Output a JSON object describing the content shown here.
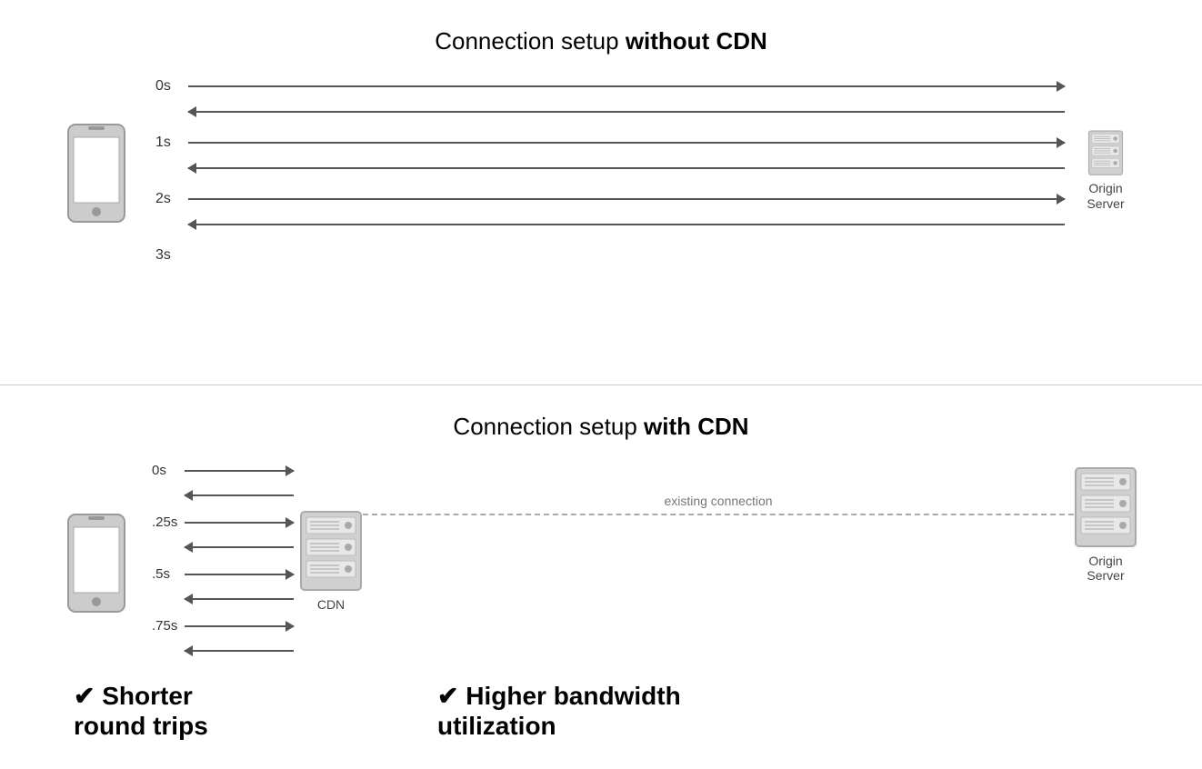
{
  "top_section": {
    "title_normal": "Connection setup ",
    "title_bold": "without CDN",
    "time_labels": [
      "0s",
      "1s",
      "2s",
      "3s"
    ],
    "server_label": "Origin\nServer"
  },
  "bottom_section": {
    "title_normal": "Connection setup ",
    "title_bold": "with CDN",
    "time_labels": [
      "0s",
      ".25s",
      ".5s",
      ".75s"
    ],
    "cdn_label": "CDN",
    "server_label": "Origin\nServer",
    "existing_connection": "existing connection",
    "benefit_left": "✔ Shorter\nround trips",
    "benefit_right": "✔ Higher bandwidth\nutilization"
  }
}
